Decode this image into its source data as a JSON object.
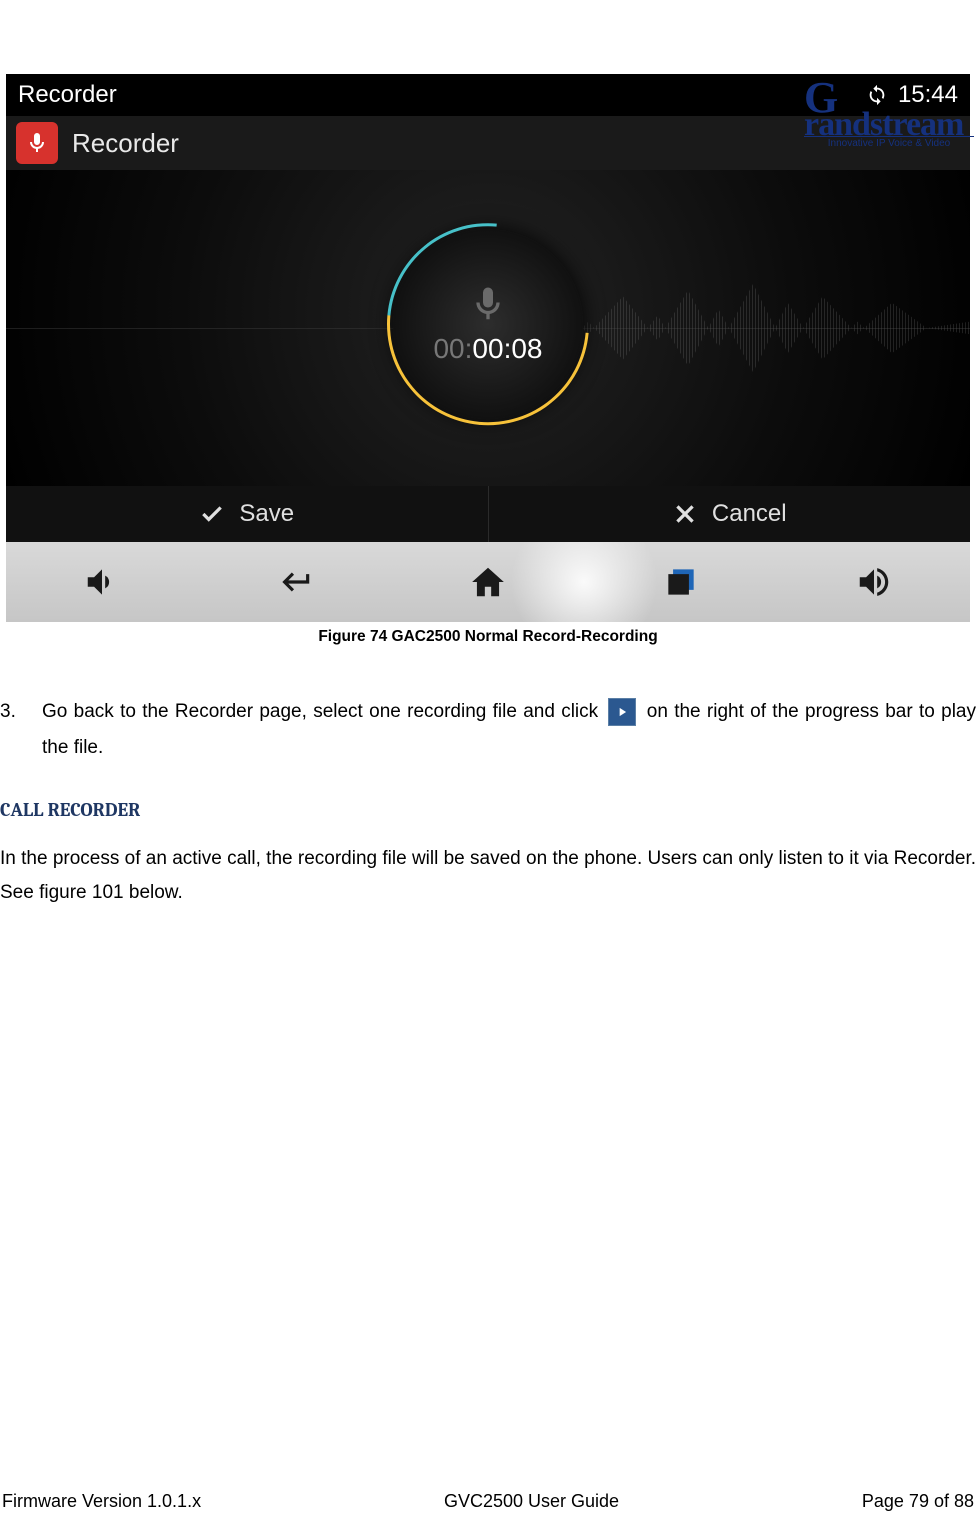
{
  "header_logo": {
    "name": "Grandstream",
    "tagline": "Innovative IP Voice & Video"
  },
  "screenshot": {
    "status_bar": {
      "app_label": "Recorder",
      "time": "15:44"
    },
    "app_header": {
      "title": "Recorder"
    },
    "recording": {
      "timer_gray_prefix": "00:",
      "timer_white": "00:08"
    },
    "actions": {
      "save": "Save",
      "cancel": "Cancel"
    }
  },
  "figure_caption": "Figure 74 GAC2500 Normal Record-Recording",
  "list": {
    "num": "3.",
    "text_before": "Go back to the Recorder page, select one recording file and click",
    "text_after": "on the right of the progress bar to play the file."
  },
  "section_title": "CALL RECORDER",
  "paragraph": "In the process of an active call, the recording file will be saved on the phone. Users can only listen to it via Recorder. See figure 101 below.",
  "footer": {
    "left": "Firmware Version 1.0.1.x",
    "center": "GVC2500 User Guide",
    "right": "Page 79 of 88"
  }
}
